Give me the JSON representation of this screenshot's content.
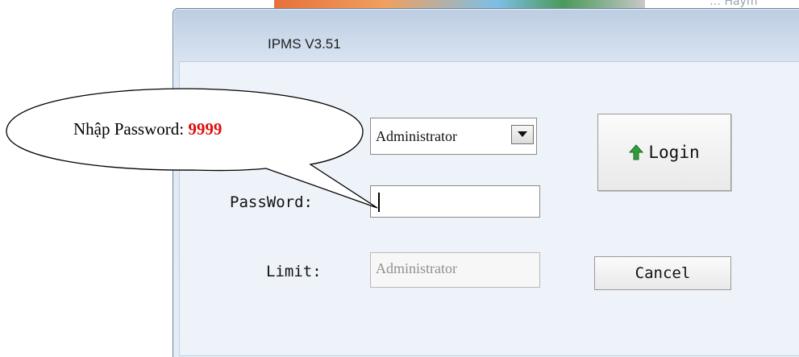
{
  "window": {
    "title": "IPMS V3.51"
  },
  "background": {
    "partial_text": "… Haym"
  },
  "form": {
    "user_select_value": "Administrator",
    "password_label": "PassWord:",
    "password_value": "",
    "limit_label": "Limit:",
    "limit_value": "Administrator"
  },
  "buttons": {
    "login_label": "Login",
    "cancel_label": "Cancel"
  },
  "callout": {
    "prefix": "Nhập Password: ",
    "value": "9999"
  },
  "colors": {
    "callout_highlight": "#e01010",
    "login_icon": "#2f9e3a"
  },
  "icons": {
    "login": "up-arrow-icon",
    "dropdown": "chevron-down-icon"
  }
}
